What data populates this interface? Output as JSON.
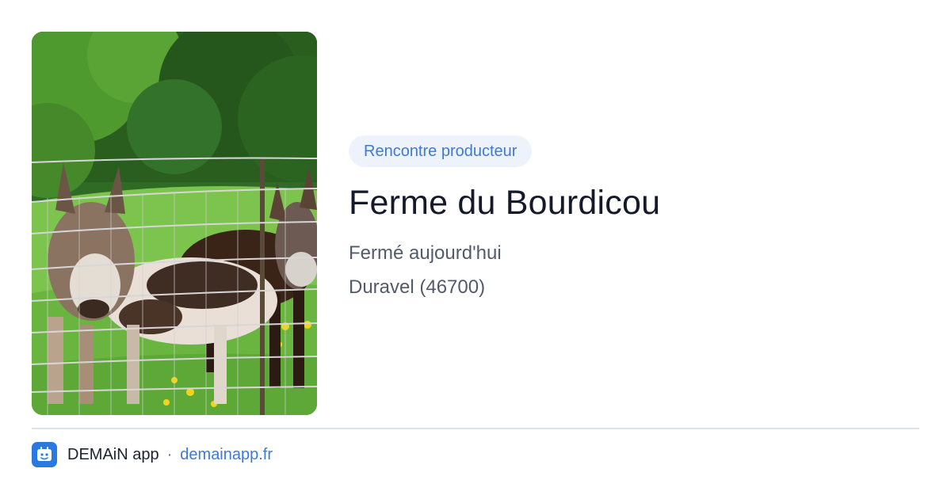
{
  "card": {
    "category_badge": "Rencontre producteur",
    "title": "Ferme du Bourdicou",
    "status": "Fermé aujourd'hui",
    "location": "Duravel (46700)"
  },
  "photo": {
    "subject": "donkeys behind a wire fence in a green meadow"
  },
  "footer": {
    "app_name": "DEMAiN app",
    "separator": "·",
    "domain": "demainapp.fr",
    "icon": "demain-app-logo-icon"
  },
  "colors": {
    "accent": "#3d7ad6",
    "badge_background": "#eef3fb",
    "title": "#141a2a",
    "secondary_text": "#525b6b",
    "divider": "#dbe3ea",
    "app_icon_background": "#2a78e2"
  }
}
